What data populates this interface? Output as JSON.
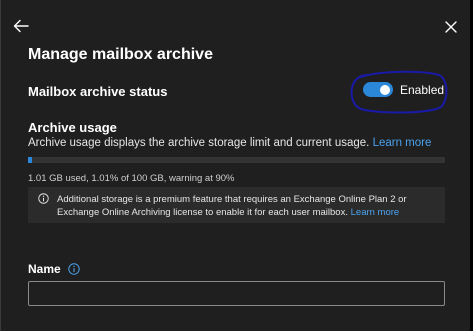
{
  "panel": {
    "title": "Manage mailbox archive",
    "back_icon": "arrow-left-icon",
    "close_icon": "close-icon"
  },
  "archive_status": {
    "label": "Mailbox archive status",
    "toggle_on": true,
    "toggle_text": "Enabled"
  },
  "archive_usage": {
    "heading": "Archive usage",
    "description": "Archive usage displays the archive storage limit and current usage.",
    "learn_more": "Learn more",
    "usage_fraction": 0.0101,
    "stats": "1.01 GB used, 1.01% of 100 GB, warning at 90%"
  },
  "info_box": {
    "icon": "info-icon",
    "text": "Additional storage is a premium feature that requires an Exchange Online Plan 2 or Exchange Online Archiving license to enable it for each user mailbox.",
    "learn_more": "Learn more"
  },
  "name_field": {
    "label": "Name",
    "info_icon": "info-icon",
    "value": "",
    "placeholder": ""
  },
  "colors": {
    "panel_bg": "#1f1f1f",
    "accent": "#2b88d8",
    "link": "#4aa3f0",
    "annotation": "#1a1aa8"
  }
}
